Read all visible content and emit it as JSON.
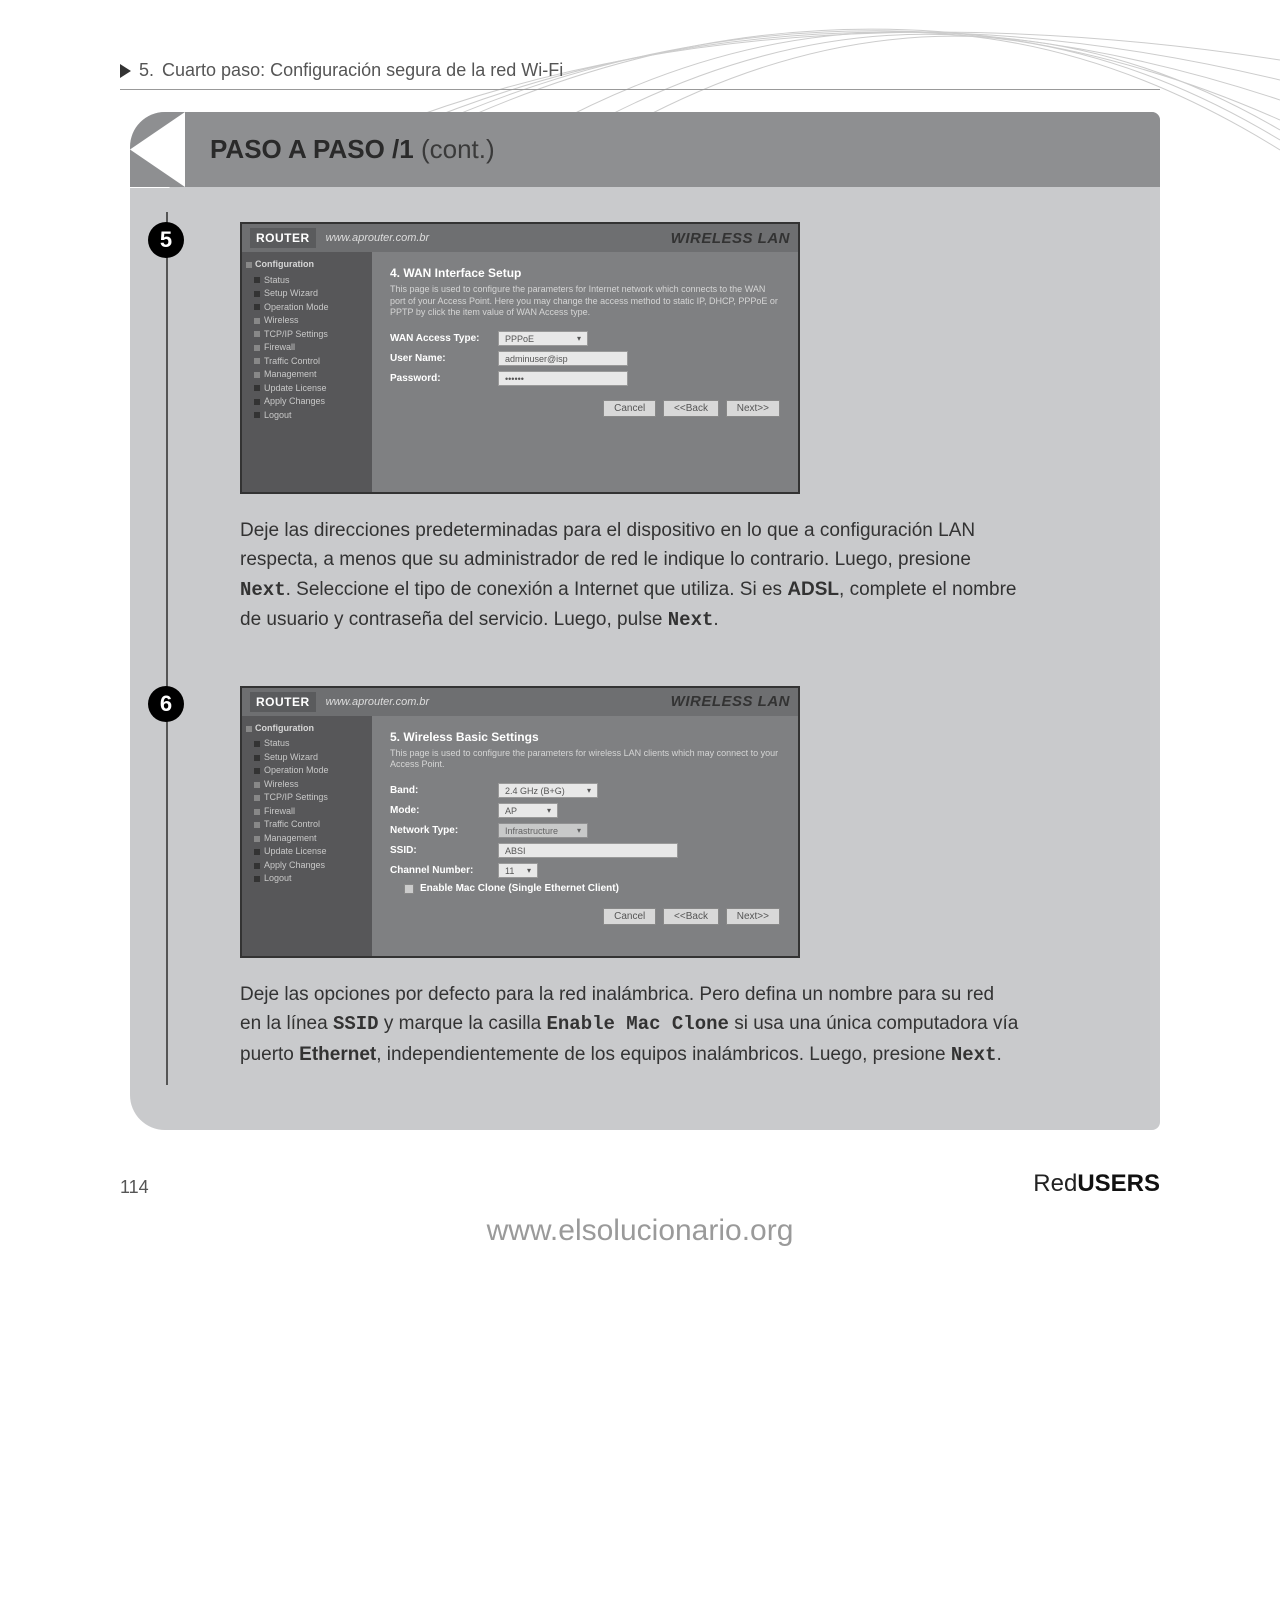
{
  "chapter": {
    "num": "5.",
    "title": "Cuarto paso: Configuración segura de la red Wi-Fi"
  },
  "card": {
    "title_main": "PASO A PASO /1",
    "title_suffix": "(cont.)"
  },
  "router": {
    "logo": "ROUTER",
    "url": "www.aprouter.com.br",
    "brand": "WIRELESS LAN",
    "nav_header": "Configuration",
    "nav_items": [
      "Status",
      "Setup Wizard",
      "Operation Mode",
      "Wireless",
      "TCP/IP Settings",
      "Firewall",
      "Traffic Control",
      "Management",
      "Update License",
      "Apply Changes",
      "Logout"
    ]
  },
  "step5": {
    "num": "5",
    "heading": "4. WAN Interface Setup",
    "desc": "This page is used to configure the parameters for Internet network which connects to the WAN port of your Access Point. Here you may change the access method to static IP, DHCP, PPPoE or PPTP by click the item value of WAN Access type.",
    "fields": {
      "access_label": "WAN Access Type:",
      "access_value": "PPPoE",
      "user_label": "User Name:",
      "user_value": "adminuser@isp",
      "pass_label": "Password:",
      "pass_value": "••••••"
    },
    "buttons": {
      "cancel": "Cancel",
      "back": "<<Back",
      "next": "Next>>"
    },
    "caption_parts": [
      "Deje las direcciones predeterminadas para el dispositivo en lo que a configuración LAN respecta, a menos que su administrador de red le indique lo contrario. Luego, presione ",
      "Next",
      ". Seleccione el tipo de conexión a Internet que utiliza. Si es ",
      "ADSL",
      ", complete el nombre de usuario y contraseña del servicio. Luego, pulse ",
      "Next",
      "."
    ]
  },
  "step6": {
    "num": "6",
    "heading": "5. Wireless Basic Settings",
    "desc": "This page is used to configure the parameters for wireless LAN clients which may connect to your Access Point.",
    "fields": {
      "band_label": "Band:",
      "band_value": "2.4 GHz (B+G)",
      "mode_label": "Mode:",
      "mode_value": "AP",
      "ntype_label": "Network Type:",
      "ntype_value": "Infrastructure",
      "ssid_label": "SSID:",
      "ssid_value": "ABSI",
      "chan_label": "Channel Number:",
      "chan_value": "11",
      "clone_label": "Enable Mac Clone (Single Ethernet Client)"
    },
    "buttons": {
      "cancel": "Cancel",
      "back": "<<Back",
      "next": "Next>>"
    },
    "caption_parts": [
      "Deje las opciones por defecto para la red inalámbrica. Pero defina un nombre para su red en la línea ",
      "SSID",
      "  y marque la casilla ",
      "Enable Mac Clone",
      "  si usa una única computadora vía puerto ",
      "Ethernet",
      ", independientemente de los equipos inalámbricos. Luego, presione ",
      "Next",
      "."
    ]
  },
  "footer": {
    "page": "114",
    "brand_red": "Red",
    "brand_users": "USERS"
  },
  "site": "www.elsolucionario.org"
}
